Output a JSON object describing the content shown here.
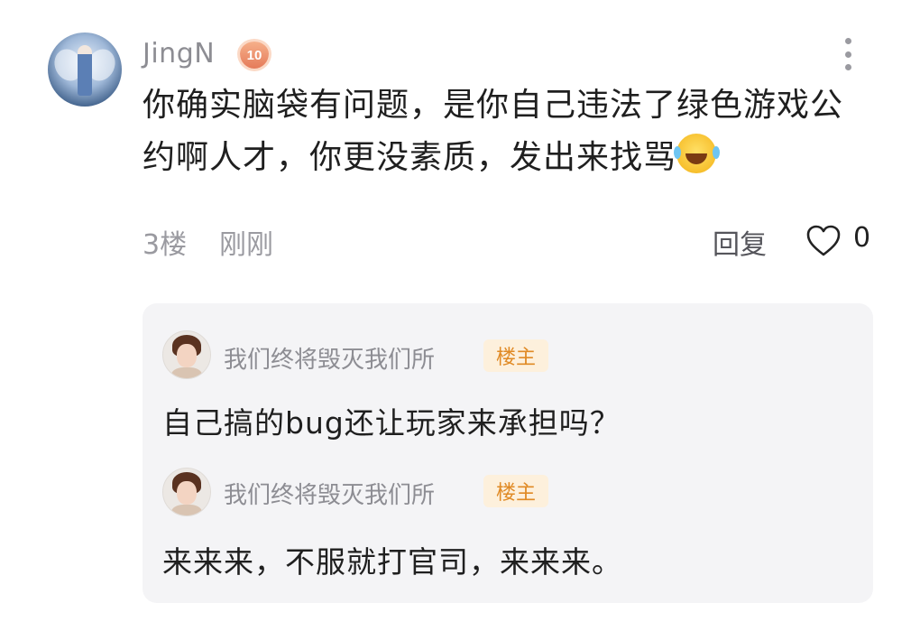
{
  "comment": {
    "username": "JingN",
    "level": "10",
    "text": "你确实脑袋有问题，是你自己违法了绿色游戏公约啊人才，你更没素质，发出来找骂",
    "floor": "3楼",
    "time": "刚刚",
    "reply_label": "回复",
    "like_count": "0"
  },
  "replies": [
    {
      "username": "我们终将毁灭我们所",
      "badge": "楼主",
      "text": "自己搞的bug还让玩家来承担吗？"
    },
    {
      "username": "我们终将毁灭我们所",
      "badge": "楼主",
      "text": "来来来，不服就打官司，来来来。"
    }
  ],
  "icons": {
    "more": "more-vertical-icon",
    "like": "heart-outline-icon",
    "emoji": "laughing-tears-emoji"
  },
  "colors": {
    "username": "#8d8d93",
    "badge_bg": "#fdf0dc",
    "badge_text": "#e08a25",
    "panel_bg": "#f4f4f6"
  }
}
